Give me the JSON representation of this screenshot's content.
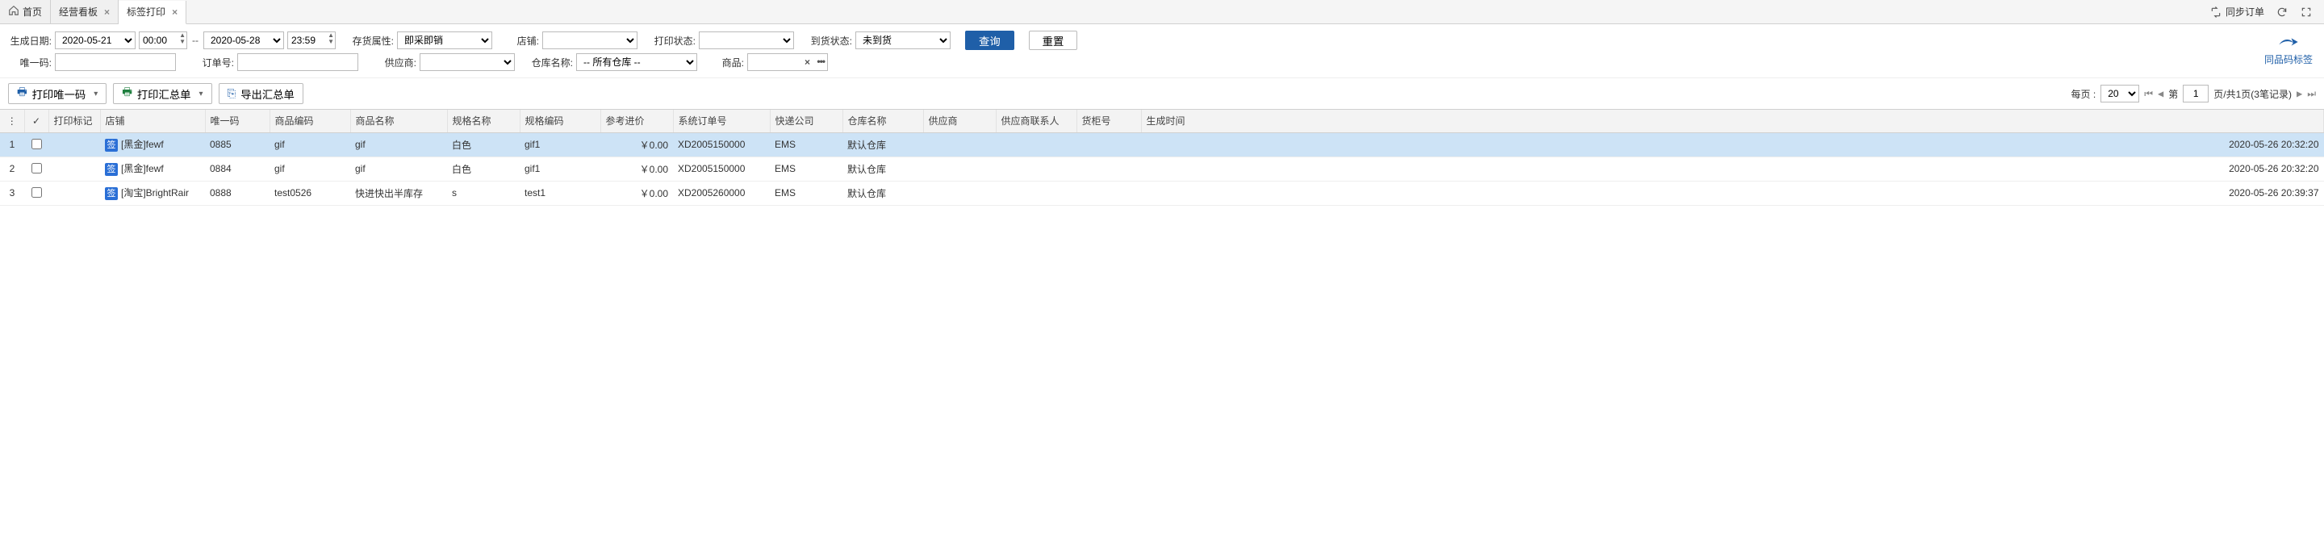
{
  "tabs": {
    "home": "首页",
    "items": [
      {
        "label": "经营看板"
      },
      {
        "label": "标签打印",
        "active": true
      }
    ],
    "sync": "同步订单"
  },
  "filters": {
    "gen_date_label": "生成日期:",
    "date_from": "2020-05-21",
    "time_from": "00:00",
    "date_sep": "--",
    "date_to": "2020-05-28",
    "time_to": "23:59",
    "stock_attr_label": "存货属性:",
    "stock_attr_value": "即采即销",
    "shop_label": "店铺:",
    "shop_value": "",
    "print_status_label": "打印状态:",
    "print_status_value": "",
    "arrive_status_label": "到货状态:",
    "arrive_status_value": "未到货",
    "query_btn": "查询",
    "reset_btn": "重置",
    "right_action": "同品码标签",
    "unique_label": "唯一码:",
    "unique_value": "",
    "order_label": "订单号:",
    "order_value": "",
    "supplier_label": "供应商:",
    "supplier_value": "",
    "warehouse_label": "仓库名称:",
    "warehouse_value": "-- 所有仓库 --",
    "product_label": "商品:",
    "product_value": ""
  },
  "toolbar": {
    "print_unique": "打印唯一码",
    "print_summary": "打印汇总单",
    "export_summary": "导出汇总单"
  },
  "paging": {
    "per_page_label": "每页 :",
    "per_page": "20",
    "page_label_prefix": "第",
    "page_current": "1",
    "page_label_suffix": "页/共1页(3笔记录)"
  },
  "columns": {
    "rownum": "",
    "check": "✓",
    "print_mark": "打印标记",
    "shop": "店铺",
    "unique": "唯一码",
    "sku": "商品编码",
    "name": "商品名称",
    "spec_name": "规格名称",
    "spec_code": "规格编码",
    "ref_price": "参考进价",
    "sys_order": "系统订单号",
    "express": "快递公司",
    "warehouse": "仓库名称",
    "supplier": "供应商",
    "supplier_contact": "供应商联系人",
    "cabinet": "货柜号",
    "gen_time": "生成时间"
  },
  "rows": [
    {
      "selected": true,
      "shop_badge": "签",
      "shop": "[黑金]fewf",
      "unique": "0885",
      "sku": "gif",
      "name": "gif",
      "spec_name": "白色",
      "spec_code": "gif1",
      "ref_price": "￥0.00",
      "sys_order": "XD2005150000",
      "express": "EMS",
      "warehouse": "默认仓库",
      "supplier": "",
      "supplier_contact": "",
      "cabinet": "",
      "gen_time": "2020-05-26 20:32:20"
    },
    {
      "selected": false,
      "shop_badge": "签",
      "shop": "[黑金]fewf",
      "unique": "0884",
      "sku": "gif",
      "name": "gif",
      "spec_name": "白色",
      "spec_code": "gif1",
      "ref_price": "￥0.00",
      "sys_order": "XD2005150000",
      "express": "EMS",
      "warehouse": "默认仓库",
      "supplier": "",
      "supplier_contact": "",
      "cabinet": "",
      "gen_time": "2020-05-26 20:32:20"
    },
    {
      "selected": false,
      "shop_badge": "签",
      "shop": "[淘宝]BrightRair",
      "unique": "0888",
      "sku": "test0526",
      "name": "快进快出半库存",
      "spec_name": "s",
      "spec_code": "test1",
      "ref_price": "￥0.00",
      "sys_order": "XD2005260000",
      "express": "EMS",
      "warehouse": "默认仓库",
      "supplier": "",
      "supplier_contact": "",
      "cabinet": "",
      "gen_time": "2020-05-26 20:39:37"
    }
  ]
}
